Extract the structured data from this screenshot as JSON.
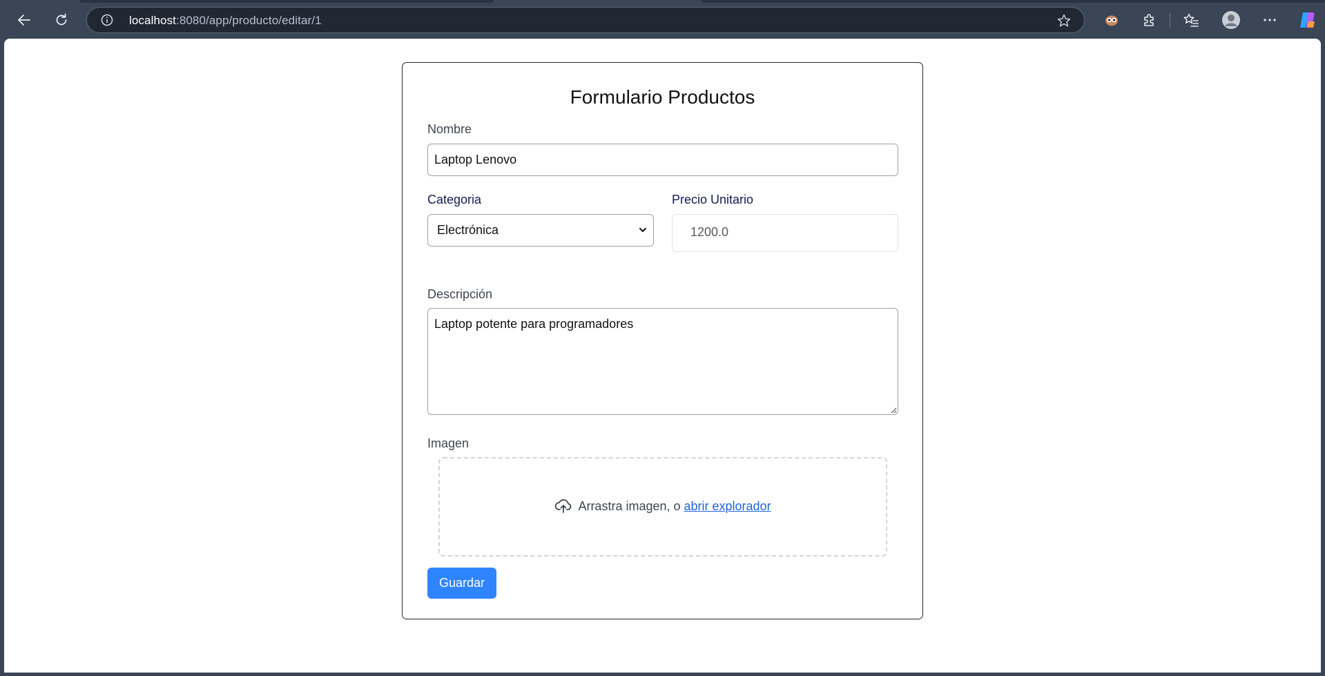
{
  "browser": {
    "url_host": "localhost",
    "url_rest": ":8080/app/producto/editar/1"
  },
  "form": {
    "title": "Formulario Productos",
    "nombre_label": "Nombre",
    "nombre_value": "Laptop Lenovo",
    "categoria_label": "Categoria",
    "categoria_selected": "Electrónica",
    "precio_label": "Precio Unitario",
    "precio_value": "1200.0",
    "descripcion_label": "Descripción",
    "descripcion_value": "Laptop potente para programadores",
    "imagen_label": "Imagen",
    "drop_text": "Arrastra imagen, o",
    "drop_link": "abrir explorador",
    "save_label": "Guardar"
  },
  "colors": {
    "accent": "#2f84ff",
    "link": "#1f64d8",
    "chrome": "#3a4556"
  }
}
